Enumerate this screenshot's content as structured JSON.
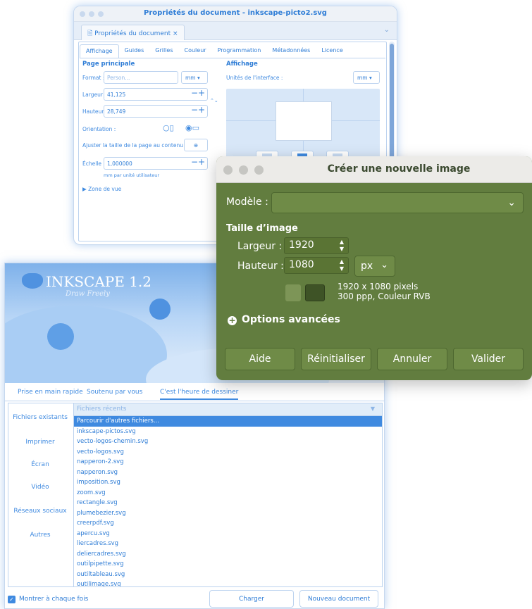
{
  "props": {
    "title": "Propriétés du document - inkscape-picto2.svg",
    "doc_tab": "Propriétés du document",
    "close_glyph": "×",
    "tabs": [
      "Affichage",
      "Guides",
      "Grilles",
      "Couleur",
      "Programmation",
      "Métadonnées",
      "Licence"
    ],
    "page": {
      "section": "Page principale",
      "format_label": "Format :",
      "format_value": "Person...",
      "unit": "mm",
      "width_label": "Largeur :",
      "width_value": "41,125",
      "height_label": "Hauteur :",
      "height_value": "28,749",
      "orientation_label": "Orientation :",
      "fit_label": "Ajuster la taille de la page au contenu :",
      "scale_label": "Échelle :",
      "scale_value": "1,000000",
      "scale_hint": "mm par unité utilisateur",
      "viewbox": "Zone de vue"
    },
    "display": {
      "section": "Affichage",
      "units_label": "Unités de l'interface :",
      "units_value": "mm"
    }
  },
  "create_image": {
    "title": "Créer une nouvelle image",
    "model_label": "Modèle :",
    "size_section": "Taille d’image",
    "width_label": "Largeur :",
    "width_value": "1920",
    "height_label": "Hauteur :",
    "height_value": "1080",
    "unit": "px",
    "info_line1": "1920 x 1080 pixels",
    "info_line2": "300 ppp, Couleur RVB",
    "advanced": "Options avancées",
    "buttons": {
      "help": "Aide",
      "reset": "Réinitialiser",
      "cancel": "Annuler",
      "ok": "Valider"
    }
  },
  "welcome": {
    "splash_title": "INKSCAPE 1.2",
    "splash_sub": "Draw Freely",
    "tabs": [
      "Prise en main rapide",
      "Soutenu par vous",
      "C'est l'heure de dessiner"
    ],
    "sidebar": [
      "Fichiers existants",
      "Imprimer",
      "Écran",
      "Vidéo",
      "Réseaux sociaux",
      "Autres"
    ],
    "recent_header": "Fichiers récents",
    "recent": [
      "Parcourir d'autres fichiers...",
      "inkscape-pictos.svg",
      "vecto-logos-chemin.svg",
      "vecto-logos.svg",
      "napperon-2.svg",
      "napperon.svg",
      "imposition.svg",
      "zoom.svg",
      "rectangle.svg",
      "plumebezier.svg",
      "creerpdf.svg",
      "apercu.svg",
      "liercadres.svg",
      "deliercadres.svg",
      "outilpipette.svg",
      "outiltableau.svg",
      "outilimage.svg"
    ],
    "show_each_time": "Montrer à chaque fois",
    "load": "Charger",
    "new_doc": "Nouveau document"
  }
}
